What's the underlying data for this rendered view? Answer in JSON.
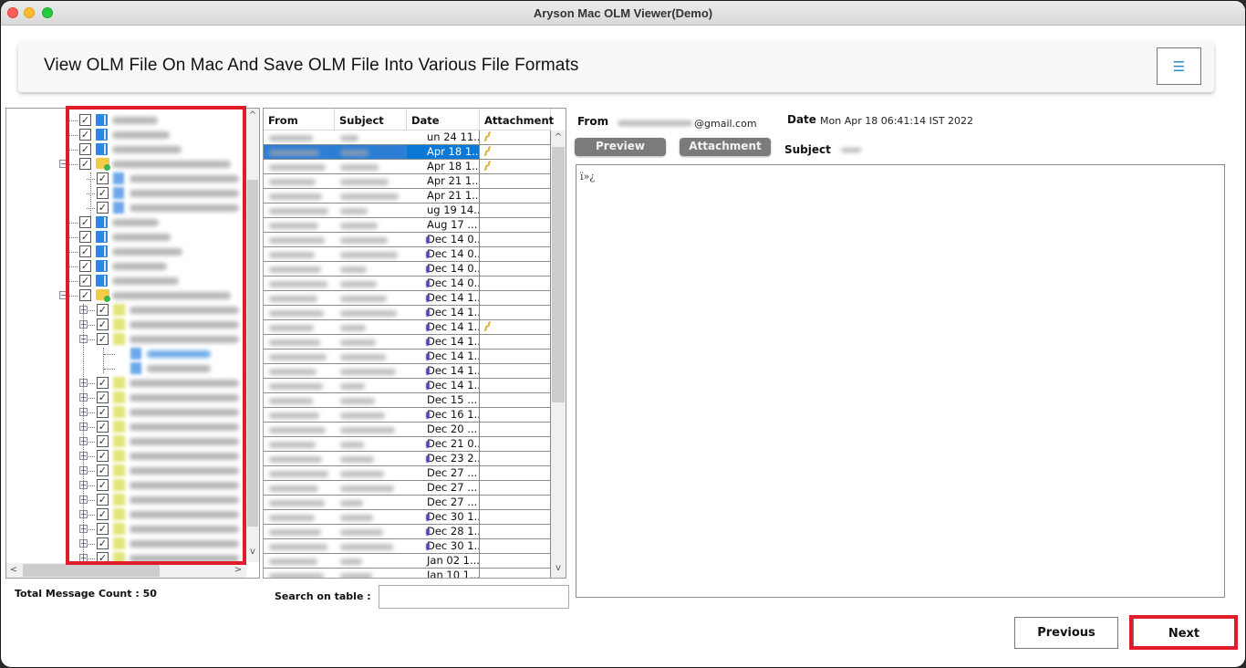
{
  "window": {
    "title": "Aryson Mac OLM Viewer(Demo)"
  },
  "header": {
    "title": "View OLM File On Mac And Save OLM File Into Various File Formats",
    "menu_icon": "hamburger-icon",
    "menu_glyph": "☰"
  },
  "tree": {
    "check_glyph": "✓",
    "plus_glyph": "+",
    "minus_glyph": "−",
    "nodes": [
      {
        "level": 1,
        "icon": "blue-folder",
        "checked": true,
        "label_hidden": true
      },
      {
        "level": 1,
        "icon": "blue-folder",
        "checked": true,
        "label_hidden": true
      },
      {
        "level": 1,
        "icon": "blue-folder",
        "checked": true,
        "label_hidden": true
      },
      {
        "level": 1,
        "icon": "account-folder",
        "checked": true,
        "expanded": true,
        "label_hidden": true
      },
      {
        "level": 2,
        "icon": "blue-folder",
        "checked": true,
        "label_hidden": true
      },
      {
        "level": 2,
        "icon": "blue-folder",
        "checked": true,
        "label_hidden": true
      },
      {
        "level": 2,
        "icon": "blue-folder",
        "checked": true,
        "label_hidden": true
      },
      {
        "level": 1,
        "icon": "blue-folder",
        "checked": true,
        "label_hidden": true
      },
      {
        "level": 1,
        "icon": "blue-folder",
        "checked": true,
        "label_hidden": true
      },
      {
        "level": 1,
        "icon": "blue-folder",
        "checked": true,
        "label_hidden": true
      },
      {
        "level": 1,
        "icon": "blue-folder",
        "checked": true,
        "label_hidden": true
      },
      {
        "level": 1,
        "icon": "blue-folder",
        "checked": true,
        "label_hidden": true
      },
      {
        "level": 1,
        "icon": "account-folder",
        "checked": true,
        "expanded": true,
        "label_hidden": true
      },
      {
        "level": 2,
        "icon": "yellow-folder",
        "checked": true,
        "collapsed": true,
        "label_hidden": true
      },
      {
        "level": 2,
        "icon": "yellow-folder",
        "checked": true,
        "collapsed": true,
        "label_hidden": true
      },
      {
        "level": 2,
        "icon": "yellow-folder",
        "checked": true,
        "expanded": true,
        "label_hidden": true
      },
      {
        "level": 3,
        "icon": "blue-folder",
        "checked": false,
        "selected": true,
        "label_hidden": true
      },
      {
        "level": 3,
        "icon": "blue-folder",
        "checked": false,
        "label_hidden": true
      },
      {
        "level": 2,
        "icon": "yellow-folder",
        "checked": true,
        "collapsed": true,
        "label_hidden": true
      },
      {
        "level": 2,
        "icon": "yellow-folder",
        "checked": true,
        "collapsed": true,
        "label_hidden": true
      },
      {
        "level": 2,
        "icon": "yellow-folder",
        "checked": true,
        "collapsed": true,
        "label_hidden": true
      },
      {
        "level": 2,
        "icon": "yellow-folder",
        "checked": true,
        "collapsed": true,
        "label_hidden": true
      },
      {
        "level": 2,
        "icon": "yellow-folder",
        "checked": true,
        "collapsed": true,
        "label_hidden": true
      },
      {
        "level": 2,
        "icon": "yellow-folder",
        "checked": true,
        "collapsed": true,
        "label_hidden": true
      },
      {
        "level": 2,
        "icon": "yellow-folder",
        "checked": true,
        "collapsed": true,
        "label_hidden": true
      },
      {
        "level": 2,
        "icon": "yellow-folder",
        "checked": true,
        "collapsed": true,
        "label_hidden": true
      },
      {
        "level": 2,
        "icon": "yellow-folder",
        "checked": true,
        "collapsed": true,
        "label_hidden": true
      },
      {
        "level": 2,
        "icon": "yellow-folder",
        "checked": true,
        "collapsed": true,
        "label_hidden": true
      },
      {
        "level": 2,
        "icon": "yellow-folder",
        "checked": true,
        "collapsed": true,
        "label_hidden": true
      },
      {
        "level": 2,
        "icon": "yellow-folder",
        "checked": true,
        "collapsed": true,
        "label_hidden": true
      },
      {
        "level": 2,
        "icon": "yellow-folder",
        "checked": true,
        "collapsed": true,
        "label_hidden": true
      }
    ],
    "scroll_up_glyph": "^",
    "scroll_down_glyph": "v",
    "scroll_left_glyph": "<",
    "scroll_right_glyph": ">",
    "vertical_scroll_fraction": 0.85,
    "horizontal_scroll_fraction": 0.0
  },
  "status": {
    "total_message_count_label": "Total Message Count : 50"
  },
  "table": {
    "columns": [
      "From",
      "Subject",
      "Date",
      "Attachment"
    ],
    "selected_row_index": 1,
    "rows": [
      {
        "date": "un 24 11...",
        "attachment": true,
        "unread": false
      },
      {
        "date": "Apr 18 1...",
        "attachment": true,
        "unread": false
      },
      {
        "date": "Apr 18 1...",
        "attachment": true,
        "unread": false
      },
      {
        "date": "Apr 21 1...",
        "attachment": false,
        "unread": false
      },
      {
        "date": "Apr 21 1...",
        "attachment": false,
        "unread": false
      },
      {
        "date": "ug 19 14...",
        "attachment": false,
        "unread": false
      },
      {
        "date": "Aug 17 ...",
        "attachment": false,
        "unread": false
      },
      {
        "date": "Dec 14 0...",
        "attachment": false,
        "unread": true
      },
      {
        "date": "Dec 14 0...",
        "attachment": false,
        "unread": true
      },
      {
        "date": "Dec 14 0...",
        "attachment": false,
        "unread": true
      },
      {
        "date": "Dec 14 0...",
        "attachment": false,
        "unread": true
      },
      {
        "date": "Dec 14 1...",
        "attachment": false,
        "unread": true
      },
      {
        "date": "Dec 14 1...",
        "attachment": false,
        "unread": true
      },
      {
        "date": "Dec 14 1...",
        "attachment": true,
        "unread": true
      },
      {
        "date": "Dec 14 1...",
        "attachment": false,
        "unread": true
      },
      {
        "date": "Dec 14 1...",
        "attachment": false,
        "unread": true
      },
      {
        "date": "Dec 14 1...",
        "attachment": false,
        "unread": true
      },
      {
        "date": "Dec 14 1...",
        "attachment": false,
        "unread": true
      },
      {
        "date": "Dec 15 ...",
        "attachment": false,
        "unread": false
      },
      {
        "date": "Dec 16 1...",
        "attachment": false,
        "unread": true
      },
      {
        "date": "Dec 20 ...",
        "attachment": false,
        "unread": false
      },
      {
        "date": "Dec 21 0...",
        "attachment": false,
        "unread": true
      },
      {
        "date": "Dec 23 2...",
        "attachment": false,
        "unread": true
      },
      {
        "date": "Dec 27 ...",
        "attachment": false,
        "unread": false
      },
      {
        "date": "Dec 27 ...",
        "attachment": false,
        "unread": false
      },
      {
        "date": "Dec 27 ...",
        "attachment": false,
        "unread": false
      },
      {
        "date": "Dec 30 1...",
        "attachment": false,
        "unread": true
      },
      {
        "date": "Dec 28 1...",
        "attachment": false,
        "unread": true
      },
      {
        "date": "Dec 30 1...",
        "attachment": false,
        "unread": true
      },
      {
        "date": "Jan 02 1...",
        "attachment": false,
        "unread": false
      },
      {
        "date": "Jan 10 1...",
        "attachment": false,
        "unread": false
      }
    ],
    "attachment_glyph": "📎",
    "scroll_up_glyph": "^",
    "scroll_down_glyph": "v",
    "vertical_scroll_fraction": 0.0
  },
  "search": {
    "label": "Search on table :",
    "value": "",
    "placeholder": ""
  },
  "preview": {
    "from_label": "From",
    "from_value": "@gmail.com",
    "date_label": "Date",
    "date_value": "Mon Apr 18 06:41:14 IST 2022",
    "subject_label": "Subject",
    "preview_button": "Preview",
    "attachment_button": "Attachment",
    "body_text": "ï»¿"
  },
  "footer": {
    "previous_button": "Previous",
    "next_button": "Next"
  },
  "colors": {
    "highlight_red": "#e21b2a",
    "selection_blue": "#0a78d7",
    "menu_icon_blue": "#2a8ad0",
    "gray_button": "#7b7b7b"
  }
}
